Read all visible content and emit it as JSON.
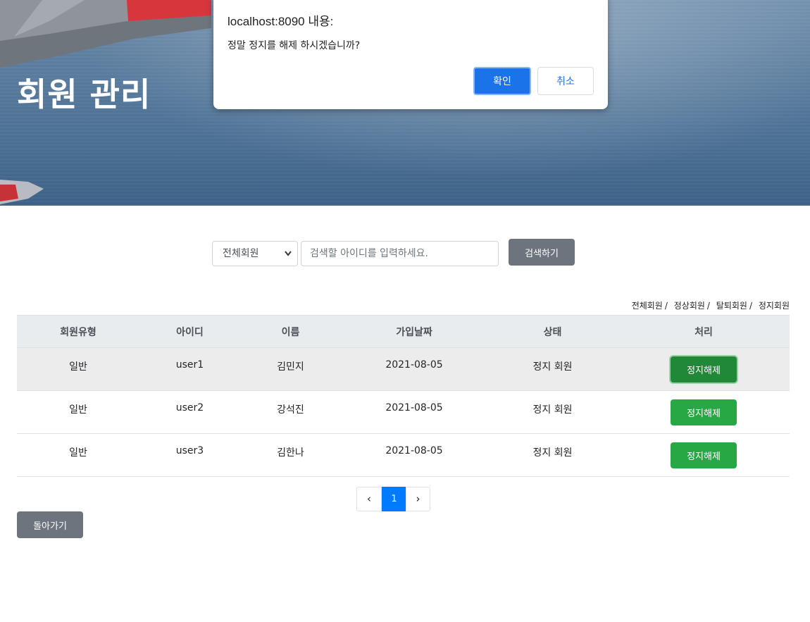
{
  "header": {
    "title": "회원 관리"
  },
  "dialog": {
    "origin": "localhost:8090 내용:",
    "message": "정말 정지를 해제 하시겠습니까?",
    "ok_label": "확인",
    "cancel_label": "취소"
  },
  "search": {
    "type_selected": "전체회원",
    "placeholder": "검색할 아이디를 입력하세요.",
    "button_label": "검색하기"
  },
  "filters": [
    "전체회원",
    "정상회원",
    "탈퇴회원",
    "정지회원"
  ],
  "filter_separator": "/",
  "table": {
    "headers": [
      "회원유형",
      "아이디",
      "이름",
      "가입날짜",
      "상태",
      "처리"
    ],
    "rows": [
      {
        "type": "일반",
        "id": "user1",
        "name": "김민지",
        "joined": "2021-08-05",
        "status": "정지 회원",
        "action": "정지해제"
      },
      {
        "type": "일반",
        "id": "user2",
        "name": "강석진",
        "joined": "2021-08-05",
        "status": "정지 회원",
        "action": "정지해제"
      },
      {
        "type": "일반",
        "id": "user3",
        "name": "김한나",
        "joined": "2021-08-05",
        "status": "정지 회원",
        "action": "정지해제"
      }
    ]
  },
  "pagination": {
    "prev": "‹",
    "current": "1",
    "next": "›"
  },
  "back_label": "돌아가기",
  "colors": {
    "primary": "#007bff",
    "success": "#28a745",
    "secondary": "#6c757d",
    "dialog_ok": "#1a73e8"
  }
}
